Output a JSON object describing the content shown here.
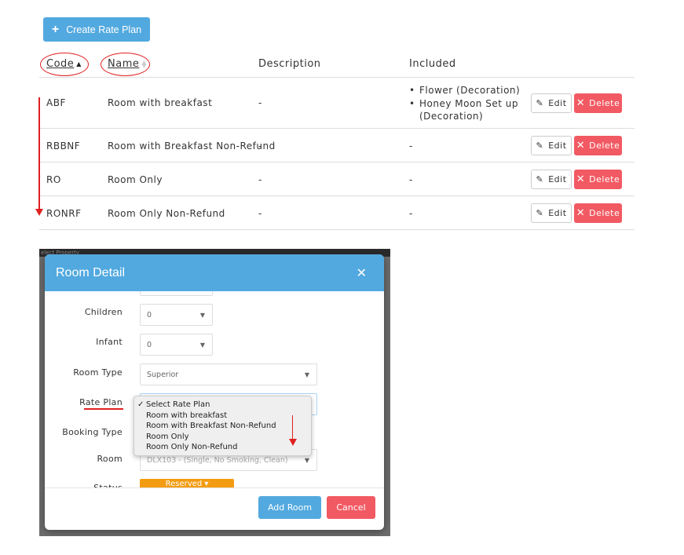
{
  "toolbar": {
    "create_label": "Create Rate Plan",
    "create_icon": "plus-icon"
  },
  "table": {
    "headers": {
      "code": "Code",
      "name": "Name",
      "description": "Description",
      "included": "Included"
    },
    "sort": {
      "column": "code",
      "direction": "asc"
    },
    "rows": [
      {
        "code": "ABF",
        "name": "Room with breakfast",
        "description": "-",
        "included": [
          "Flower (Decoration)",
          "Honey Moon Set up",
          "(Decoration)"
        ]
      },
      {
        "code": "RBBNF",
        "name": "Room with Breakfast Non-Refund",
        "description": "-",
        "included": "-"
      },
      {
        "code": "RO",
        "name": "Room Only",
        "description": "-",
        "included": "-"
      },
      {
        "code": "RONRF",
        "name": "Room Only Non-Refund",
        "description": "-",
        "included": "-"
      }
    ],
    "edit_label": "Edit",
    "delete_label": "Delete"
  },
  "modal": {
    "bg_text": "elect Property",
    "title": "Room Detail",
    "close_icon": "close-icon",
    "fields": {
      "children": {
        "label": "Children",
        "value": "0"
      },
      "infant": {
        "label": "Infant",
        "value": "0"
      },
      "room_type": {
        "label": "Room Type",
        "value": "Superior"
      },
      "rate_plan": {
        "label": "Rate Plan",
        "value": "Select Rate Plan"
      },
      "booking_type": {
        "label": "Booking Type"
      },
      "room": {
        "label": "Room",
        "value": "DLX103 - (Single, No Smoking, Clean)"
      },
      "status": {
        "label": "Status",
        "value": "Reserved"
      }
    },
    "rate_plan_options": [
      "Select Rate Plan",
      "Room with breakfast",
      "Room with Breakfast Non-Refund",
      "Room Only",
      "Room Only Non-Refund"
    ],
    "selected_option_index": 0,
    "add_label": "Add Room",
    "cancel_label": "Cancel"
  },
  "colors": {
    "primary": "#52a9df",
    "danger": "#f25a63",
    "warning": "#f39c12",
    "annotation": "#e02020"
  }
}
